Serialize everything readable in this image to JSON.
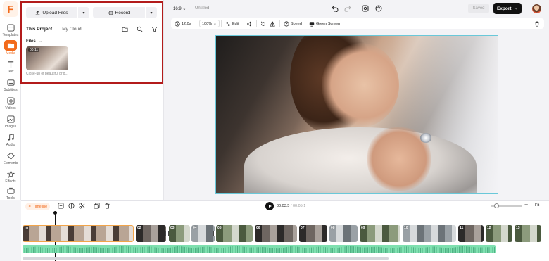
{
  "rail": {
    "logo": "F",
    "items": [
      {
        "label": "Templates",
        "icon": "templates-icon"
      },
      {
        "label": "Media",
        "icon": "media-icon",
        "active": true
      },
      {
        "label": "Text",
        "icon": "text-icon"
      },
      {
        "label": "Subtitles",
        "icon": "subtitles-icon"
      },
      {
        "label": "Videos",
        "icon": "videos-icon"
      },
      {
        "label": "Images",
        "icon": "images-icon"
      },
      {
        "label": "Audio",
        "icon": "audio-icon"
      },
      {
        "label": "Elements",
        "icon": "elements-icon"
      },
      {
        "label": "Effects",
        "icon": "effects-icon"
      },
      {
        "label": "Tools",
        "icon": "tools-icon"
      }
    ]
  },
  "panel": {
    "upload_label": "Upload Files",
    "record_label": "Record",
    "tabs": [
      {
        "label": "This Project",
        "active": true
      },
      {
        "label": "My Cloud",
        "active": false
      }
    ],
    "files_label": "Files",
    "media": [
      {
        "duration": "00:11",
        "caption": "Close-up of beautiful brid..."
      }
    ]
  },
  "topbar": {
    "aspect": "16:9",
    "title": "Untitled",
    "saved_label": "Saved",
    "export_label": "Export"
  },
  "edit_bar": {
    "duration": "12.0s",
    "zoom": "100%",
    "edit_label": "Edit",
    "speed_label": "Speed",
    "green_screen_label": "Green Screen"
  },
  "timeline": {
    "label": "Timeline",
    "current_time": "00:03.5",
    "total_time": "00:05.1",
    "fit_label": "Fit",
    "zoom_level": 0.12,
    "clips": [
      "01",
      "02",
      "03",
      "04",
      "05",
      "06",
      "07",
      "08",
      "09",
      "10",
      "11",
      "12",
      "13"
    ]
  },
  "colors": {
    "accent": "#f26a1b",
    "highlight_box": "#b31b1b",
    "canvas_border": "#69c8d9",
    "audio_track": "#7fe0b0"
  }
}
